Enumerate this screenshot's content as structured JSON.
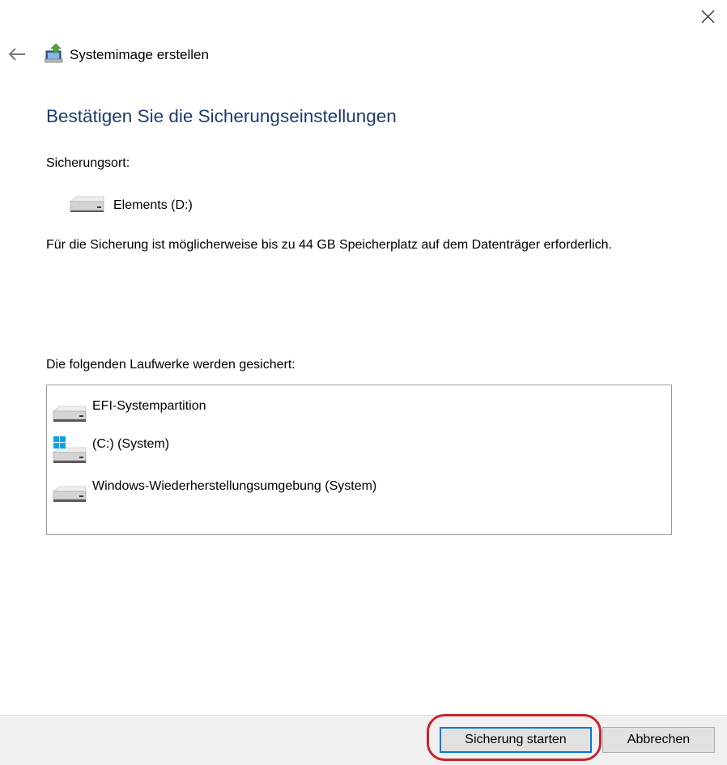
{
  "window": {
    "title": "Systemimage erstellen"
  },
  "page": {
    "heading": "Bestätigen Sie die Sicherungseinstellungen",
    "location_label": "Sicherungsort:",
    "location_name": "Elements (D:)",
    "space_note": "Für die Sicherung ist möglicherweise bis zu 44 GB Speicherplatz auf dem Datenträger erforderlich.",
    "drives_label": "Die folgenden Laufwerke werden gesichert:"
  },
  "drives": [
    {
      "label": "EFI-Systempartition",
      "icon": "drive-icon"
    },
    {
      "label": "(C:) (System)",
      "icon": "windows-drive-icon"
    },
    {
      "label": "Windows-Wiederherstellungsumgebung (System)",
      "icon": "drive-icon"
    }
  ],
  "footer": {
    "start_label": "Sicherung starten",
    "cancel_label": "Abbrechen"
  },
  "colors": {
    "heading": "#1e3a70",
    "primary_button_border": "#0078d7",
    "annotation_ring": "#c4262e",
    "footer_bg": "#f0f0f0"
  }
}
